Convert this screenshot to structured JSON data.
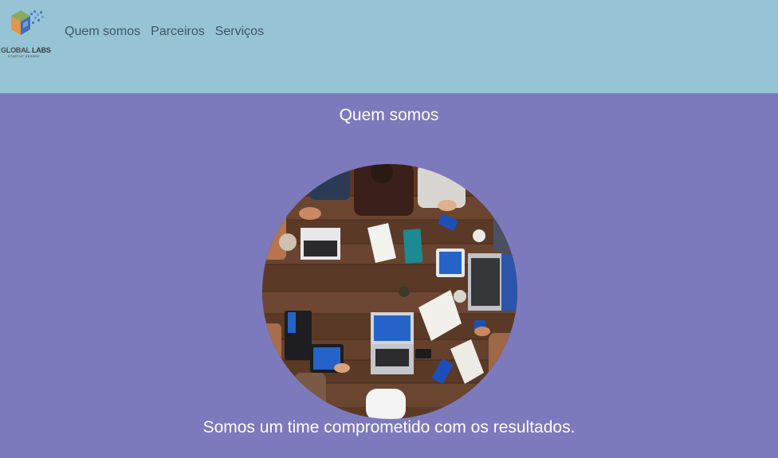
{
  "header": {
    "logo": {
      "brand_primary": "GLOBAL",
      "brand_secondary": "LABS",
      "tagline": "STARTUP DEGREE",
      "icon": "cube-logo-icon"
    },
    "nav": [
      {
        "label": "Quem somos"
      },
      {
        "label": "Parceiros"
      },
      {
        "label": "Serviços"
      }
    ]
  },
  "main": {
    "title": "Quem somos",
    "image": {
      "icon": "team-meeting-photo"
    },
    "tagline": "Somos um time comprometido com os resultados."
  },
  "colors": {
    "header_bg": "#96c4d5",
    "main_bg": "#7d79bd",
    "nav_text": "#3e5560",
    "main_text": "#ffffff"
  }
}
